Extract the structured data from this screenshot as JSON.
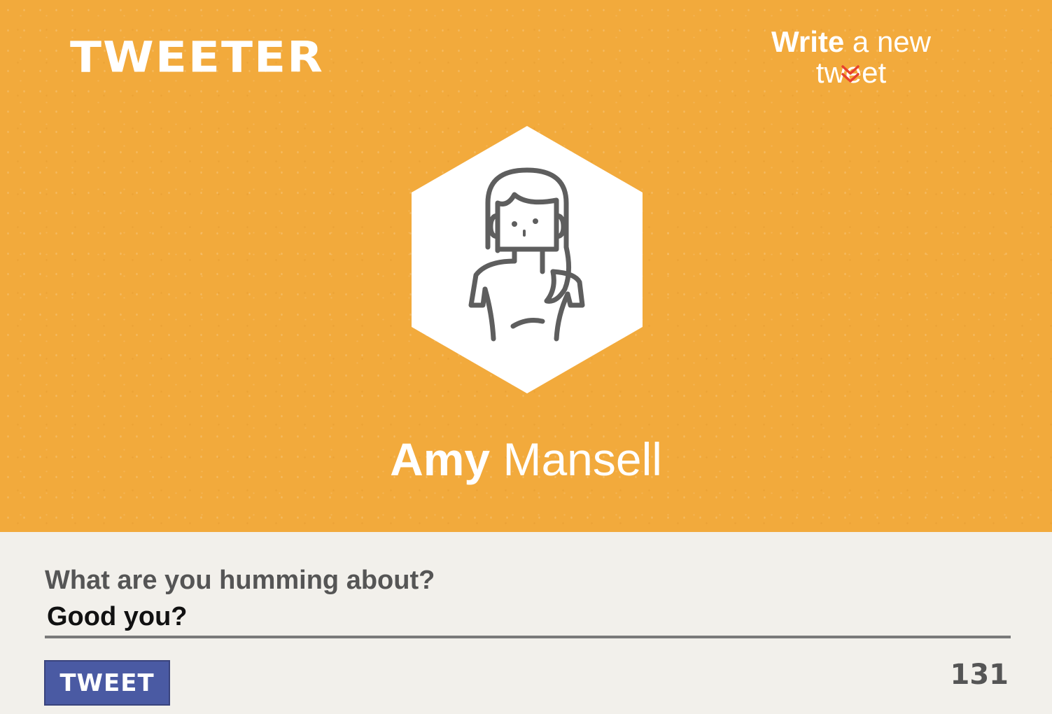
{
  "header": {
    "logo_text": "TWEETER",
    "write_link": {
      "strong": "Write",
      "rest": " a new tweet"
    },
    "chevron_icon": "double-chevron-down-icon",
    "chevron_color": "#e8412c"
  },
  "profile": {
    "avatar_icon": "user-avatar-icon",
    "first_name": "Amy",
    "last_name": " Mansell"
  },
  "composer": {
    "label": "What are you humming about?",
    "value": "Good you?",
    "button_label": "TWEET",
    "char_count": "131"
  },
  "colors": {
    "hero_background": "#f2aa3c",
    "page_background": "#f2f0eb",
    "button_background": "#4a5aa3"
  }
}
